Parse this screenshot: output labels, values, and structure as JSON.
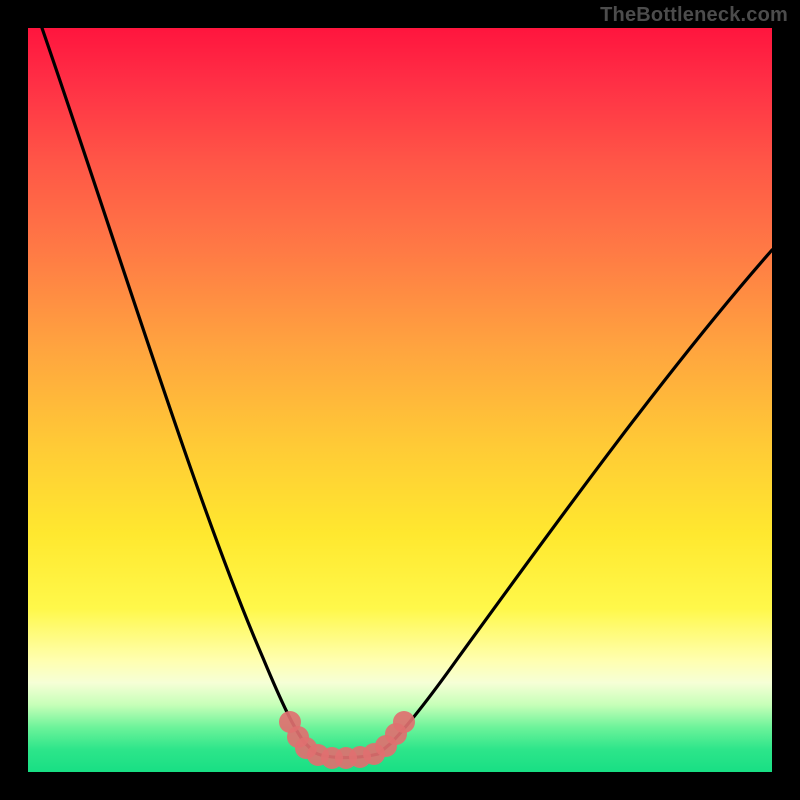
{
  "watermark": "TheBottleneck.com",
  "colors": {
    "frame": "#000000",
    "curve_stroke": "#000000",
    "band_color": "#e07070"
  },
  "chart_data": {
    "type": "line",
    "title": "",
    "xlabel": "",
    "ylabel": "",
    "xlim": [
      0,
      100
    ],
    "ylim": [
      0,
      100
    ],
    "x": [
      0,
      4,
      8,
      12,
      16,
      20,
      24,
      28,
      32,
      34.5,
      37,
      40,
      43,
      46,
      49,
      54,
      60,
      66,
      72,
      78,
      84,
      90,
      96,
      100
    ],
    "values": [
      100,
      90,
      80,
      70,
      60,
      50,
      40,
      30,
      18,
      8,
      1,
      0,
      0,
      0,
      1,
      6,
      14,
      22,
      30,
      38,
      46,
      54,
      62,
      67
    ],
    "annotations": [
      {
        "kind": "highlight-band",
        "x_start": 34,
        "x_end": 50,
        "y_near": 0
      }
    ]
  }
}
